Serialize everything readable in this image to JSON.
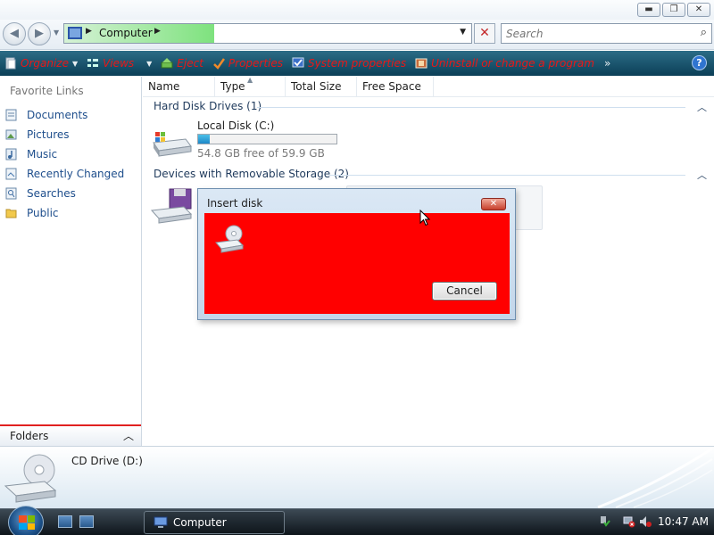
{
  "window": {
    "buttons": {
      "minimize": "▬",
      "maximize": "❐",
      "close": "✕"
    }
  },
  "address": {
    "location": "Computer",
    "search_placeholder": "Search"
  },
  "commandbar": {
    "items": [
      {
        "label": "Organize",
        "icon": "organize-icon",
        "has_dropdown": true
      },
      {
        "label": "Views",
        "icon": "views-icon",
        "has_dropdown": true
      },
      {
        "label": "Eject",
        "icon": "eject-icon",
        "has_dropdown": false
      },
      {
        "label": "Properties",
        "icon": "properties-icon",
        "has_dropdown": false
      },
      {
        "label": "System properties",
        "icon": "system-properties-icon",
        "has_dropdown": false
      },
      {
        "label": "Uninstall or change a program",
        "icon": "uninstall-icon",
        "has_dropdown": false
      }
    ],
    "more": "»",
    "help": "?",
    "text_color": "#e81818",
    "bar_color": "#1a5470"
  },
  "navpane": {
    "title": "Favorite Links",
    "items": [
      {
        "label": "Documents",
        "icon": "documents-icon"
      },
      {
        "label": "Pictures",
        "icon": "pictures-icon"
      },
      {
        "label": "Music",
        "icon": "music-icon"
      },
      {
        "label": "Recently Changed",
        "icon": "recently-changed-icon"
      },
      {
        "label": "Searches",
        "icon": "searches-icon"
      },
      {
        "label": "Public",
        "icon": "public-folder-icon"
      }
    ],
    "folders_label": "Folders"
  },
  "content": {
    "columns": [
      "Name",
      "Type",
      "Total Size",
      "Free Space"
    ],
    "groups": [
      {
        "title": "Hard Disk Drives (1)"
      },
      {
        "title": "Devices with Removable Storage (2)"
      }
    ],
    "local_disk": {
      "name": "Local Disk (C:)",
      "space_text": "54.8 GB free of 59.9 GB",
      "used_fraction": 0.085
    }
  },
  "dialog": {
    "title": "Insert disk",
    "close": "✕",
    "cancel_label": "Cancel",
    "body_color": "#ff0000"
  },
  "details": {
    "name": "CD Drive (D:)"
  },
  "taskbar": {
    "task_label": "Computer",
    "clock": "10:47 AM"
  }
}
